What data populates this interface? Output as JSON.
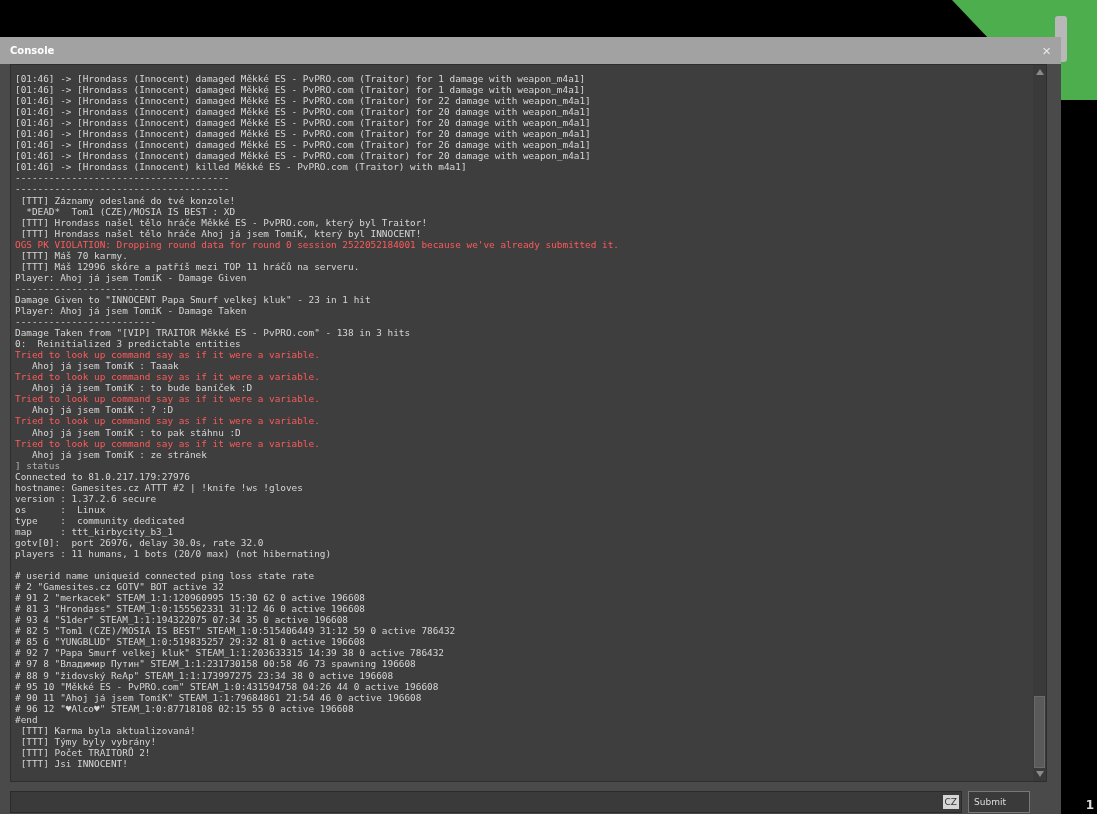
{
  "window": {
    "title": "Console",
    "close": "×"
  },
  "log": [
    {
      "kind": "log",
      "text": "[01:46] -> [Hrondass (Innocent) damaged Měkké ES - PvPRO.com (Traitor) for 1 damage with weapon_m4a1]"
    },
    {
      "kind": "log",
      "text": "[01:46] -> [Hrondass (Innocent) damaged Měkké ES - PvPRO.com (Traitor) for 1 damage with weapon_m4a1]"
    },
    {
      "kind": "log",
      "text": "[01:46] -> [Hrondass (Innocent) damaged Měkké ES - PvPRO.com (Traitor) for 22 damage with weapon_m4a1]"
    },
    {
      "kind": "log",
      "text": "[01:46] -> [Hrondass (Innocent) damaged Měkké ES - PvPRO.com (Traitor) for 20 damage with weapon_m4a1]"
    },
    {
      "kind": "log",
      "text": "[01:46] -> [Hrondass (Innocent) damaged Měkké ES - PvPRO.com (Traitor) for 20 damage with weapon_m4a1]"
    },
    {
      "kind": "log",
      "text": "[01:46] -> [Hrondass (Innocent) damaged Měkké ES - PvPRO.com (Traitor) for 20 damage with weapon_m4a1]"
    },
    {
      "kind": "log",
      "text": "[01:46] -> [Hrondass (Innocent) damaged Měkké ES - PvPRO.com (Traitor) for 26 damage with weapon_m4a1]"
    },
    {
      "kind": "log",
      "text": "[01:46] -> [Hrondass (Innocent) damaged Měkké ES - PvPRO.com (Traitor) for 20 damage with weapon_m4a1]"
    },
    {
      "kind": "log",
      "text": "[01:46] -> [Hrondass (Innocent) killed Měkké ES - PvPRO.com (Traitor) with m4a1]"
    },
    {
      "kind": "log",
      "text": "--------------------------------------"
    },
    {
      "kind": "log",
      "text": "--------------------------------------"
    },
    {
      "kind": "log",
      "text": " [TTT] Záznamy odeslané do tvé konzole!"
    },
    {
      "kind": "log",
      "text": "  *DEAD*  Tom1 (CZE)/MOSIA IS BEST : XD"
    },
    {
      "kind": "log",
      "text": " [TTT] Hrondass našel tělo hráče Měkké ES - PvPRO.com, který byl Traitor!"
    },
    {
      "kind": "log",
      "text": " [TTT] Hrondass našel tělo hráče Ahoj já jsem TomíK, který byl INNOCENT!"
    },
    {
      "kind": "error",
      "text": "OGS PK VIOLATION: Dropping round data for round 0 session 2522052184001 because we've already submitted it."
    },
    {
      "kind": "log",
      "text": " [TTT] Máš 70 karmy."
    },
    {
      "kind": "log",
      "text": " [TTT] Máš 12996 skóre a patříš mezi TOP 11 hráčů na serveru."
    },
    {
      "kind": "log",
      "text": "Player: Ahoj já jsem TomíK - Damage Given"
    },
    {
      "kind": "log",
      "text": "-------------------------"
    },
    {
      "kind": "log",
      "text": "Damage Given to \"INNOCENT Papa Smurf velkej kluk\" - 23 in 1 hit"
    },
    {
      "kind": "log",
      "text": "Player: Ahoj já jsem TomíK - Damage Taken"
    },
    {
      "kind": "log",
      "text": "-------------------------"
    },
    {
      "kind": "log",
      "text": "Damage Taken from \"[VIP] TRAITOR Měkké ES - PvPRO.com\" - 138 in 3 hits"
    },
    {
      "kind": "log",
      "text": "0:  Reinitialized 3 predictable entities"
    },
    {
      "kind": "error",
      "text": "Tried to look up command say as if it were a variable."
    },
    {
      "kind": "log",
      "text": "   Ahoj já jsem TomíK : Taaak"
    },
    {
      "kind": "error",
      "text": "Tried to look up command say as if it were a variable."
    },
    {
      "kind": "log",
      "text": "   Ahoj já jsem TomíK : to bude baníček :D"
    },
    {
      "kind": "error",
      "text": "Tried to look up command say as if it were a variable."
    },
    {
      "kind": "log",
      "text": "   Ahoj já jsem TomíK : ? :D"
    },
    {
      "kind": "error",
      "text": "Tried to look up command say as if it were a variable."
    },
    {
      "kind": "log",
      "text": "   Ahoj já jsem TomíK : to pak stáhnu :D"
    },
    {
      "kind": "error",
      "text": "Tried to look up command say as if it were a variable."
    },
    {
      "kind": "log",
      "text": "   Ahoj já jsem TomíK : ze stránek"
    },
    {
      "kind": "command",
      "text": "] status"
    },
    {
      "kind": "log",
      "text": "Connected to 81.0.217.179:27976"
    },
    {
      "kind": "log",
      "text": "hostname: Gamesites.cz ATTT #2 | !knife !ws !gloves"
    },
    {
      "kind": "log",
      "text": "version : 1.37.2.6 secure"
    },
    {
      "kind": "log",
      "text": "os      :  Linux"
    },
    {
      "kind": "log",
      "text": "type    :  community dedicated"
    },
    {
      "kind": "log",
      "text": "map     : ttt_kirbycity_b3_1"
    },
    {
      "kind": "log",
      "text": "gotv[0]:  port 26976, delay 30.0s, rate 32.0"
    },
    {
      "kind": "log",
      "text": "players : 11 humans, 1 bots (20/0 max) (not hibernating)"
    },
    {
      "kind": "blank"
    },
    {
      "kind": "log",
      "text": "# userid name uniqueid connected ping loss state rate"
    },
    {
      "kind": "log",
      "text": "# 2 \"Gamesites.cz GOTV\" BOT active 32"
    },
    {
      "kind": "log",
      "text": "# 91 2 \"merkacek\" STEAM_1:1:120960995 15:30 62 0 active 196608"
    },
    {
      "kind": "log",
      "text": "# 81 3 \"Hrondass\" STEAM_1:0:155562331 31:12 46 0 active 196608"
    },
    {
      "kind": "log",
      "text": "# 93 4 \"S1der\" STEAM_1:1:194322075 07:34 35 0 active 196608"
    },
    {
      "kind": "log",
      "text": "# 82 5 \"Tom1 (CZE)/MOSIA IS BEST\" STEAM_1:0:515406449 31:12 59 0 active 786432"
    },
    {
      "kind": "log",
      "text": "# 85 6 \"YUNGBLUD\" STEAM_1:0:519835257 29:32 81 0 active 196608"
    },
    {
      "kind": "log",
      "text": "# 92 7 \"Papa Smurf velkej kluk\" STEAM_1:1:203633315 14:39 38 0 active 786432"
    },
    {
      "kind": "log",
      "text": "# 97 8 \"Владимир Путин\" STEAM_1:1:231730158 00:58 46 73 spawning 196608"
    },
    {
      "kind": "log",
      "text": "# 88 9 \"židovský ReAp\" STEAM_1:1:173997275 23:34 38 0 active 196608"
    },
    {
      "kind": "log",
      "text": "# 95 10 \"Měkké ES - PvPRO.com\" STEAM_1:0:431594758 04:26 44 0 active 196608"
    },
    {
      "kind": "log",
      "text": "# 90 11 \"Ahoj já jsem TomíK\" STEAM_1:1:79684861 21:54 46 0 active 196608"
    },
    {
      "kind": "log",
      "text": "# 96 12 \"♥Alco♥\" STEAM_1:0:87718108 02:15 55 0 active 196608"
    },
    {
      "kind": "log",
      "text": "#end"
    },
    {
      "kind": "log",
      "text": " [TTT] Karma byla aktualizovaná!"
    },
    {
      "kind": "log",
      "text": " [TTT] Týmy byly vybrány!"
    },
    {
      "kind": "log",
      "text": " [TTT] Počet TRAITORŮ 2!"
    },
    {
      "kind": "log",
      "text": " [TTT] Jsi INNOCENT!"
    }
  ],
  "input": {
    "language": "CZ",
    "submit": "Submit"
  },
  "corner_number": "1"
}
